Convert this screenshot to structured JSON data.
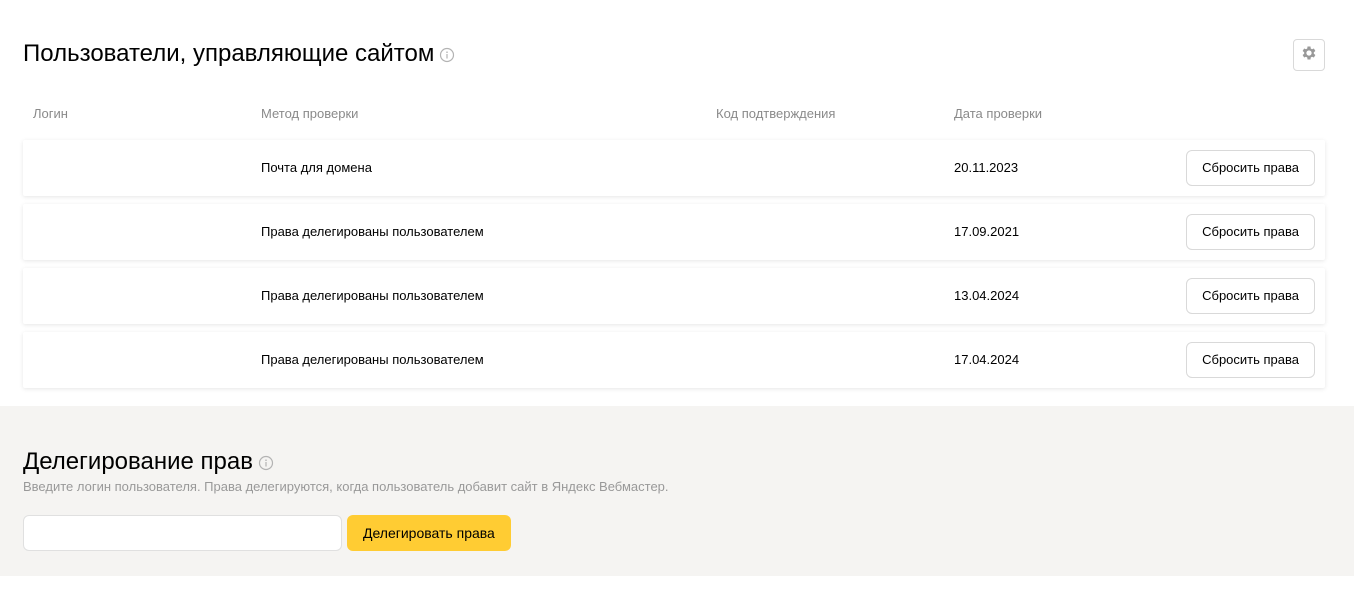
{
  "users_section": {
    "title": "Пользователи, управляющие сайтом",
    "columns": {
      "login": "Логин",
      "method": "Метод проверки",
      "code": "Код подтверждения",
      "date": "Дата проверки"
    },
    "rows": [
      {
        "login": "",
        "method": "Почта для домена",
        "code": "",
        "date": "20.11.2023",
        "action": "Сбросить права"
      },
      {
        "login": "",
        "method": "Права делегированы пользователем",
        "code": "",
        "date": "17.09.2021",
        "action": "Сбросить права"
      },
      {
        "login": "",
        "method": "Права делегированы пользователем",
        "code": "",
        "date": "13.04.2024",
        "action": "Сбросить права"
      },
      {
        "login": "",
        "method": "Права делегированы пользователем",
        "code": "",
        "date": "17.04.2024",
        "action": "Сбросить права"
      }
    ]
  },
  "delegation_section": {
    "title": "Делегирование прав",
    "hint": "Введите логин пользователя. Права делегируются, когда пользователь добавит сайт в Яндекс Вебмастер.",
    "input_value": "",
    "button_label": "Делегировать права"
  },
  "icons": {
    "info": "info-icon",
    "settings": "gear-icon"
  },
  "colors": {
    "accent": "#ffcc33",
    "section_bg": "#f5f4f2",
    "muted_text": "#8a8a8a"
  }
}
